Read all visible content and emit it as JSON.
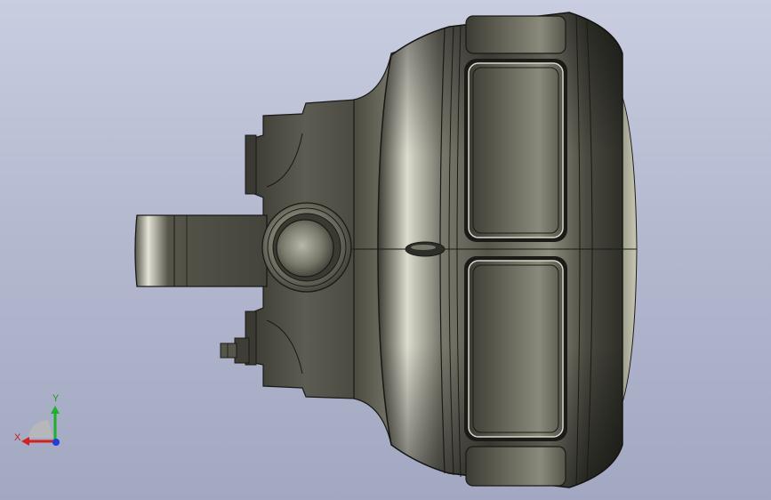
{
  "viewport": {
    "background_top": "#c9cde0",
    "background_bottom": "#a3a8c2"
  },
  "model": {
    "body_color": "#4a4a40",
    "highlight_color": "#e8e8dc",
    "edge_color": "#1a1a16"
  },
  "triad": {
    "x_label": "X",
    "y_label": "Y",
    "x_color": "#d42020",
    "y_color": "#1fb02a",
    "z_color": "#1e3fd8",
    "x_label_color": "#c02020",
    "y_label_color": "#1a9a20"
  }
}
